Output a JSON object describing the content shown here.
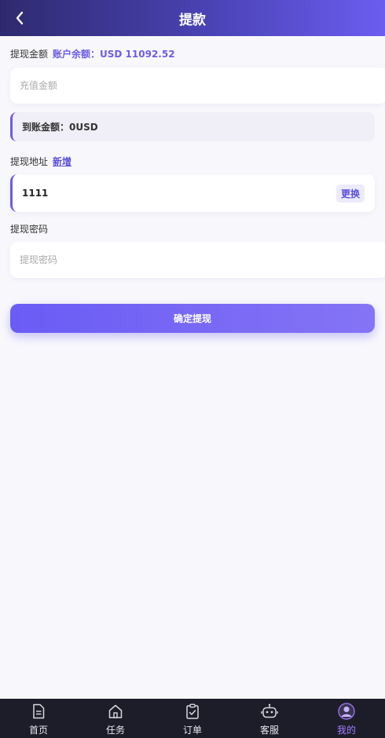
{
  "header": {
    "title": "提款"
  },
  "amount": {
    "label": "提现金额",
    "balance_text": "账户余额：USD 11092.52",
    "placeholder": "充值金额",
    "value": ""
  },
  "arrival": {
    "text": "到账金额：0USD"
  },
  "address": {
    "label": "提现地址",
    "add_link": "新增",
    "value": "1111",
    "change_button": "更换"
  },
  "password": {
    "label": "提现密码",
    "placeholder": "提现密码",
    "value": ""
  },
  "submit": {
    "label": "确定提现"
  },
  "tabbar": {
    "items": [
      {
        "label": "首页",
        "icon": "document-icon",
        "active": false
      },
      {
        "label": "任务",
        "icon": "home-icon",
        "active": false
      },
      {
        "label": "订单",
        "icon": "clipboard-icon",
        "active": false
      },
      {
        "label": "客服",
        "icon": "robot-icon",
        "active": false
      },
      {
        "label": "我的",
        "icon": "user-avatar-icon",
        "active": true
      }
    ]
  },
  "colors": {
    "accent": "#6c5ce7",
    "active_tab": "#a67cff",
    "tabbar_bg": "#1d1d29"
  }
}
